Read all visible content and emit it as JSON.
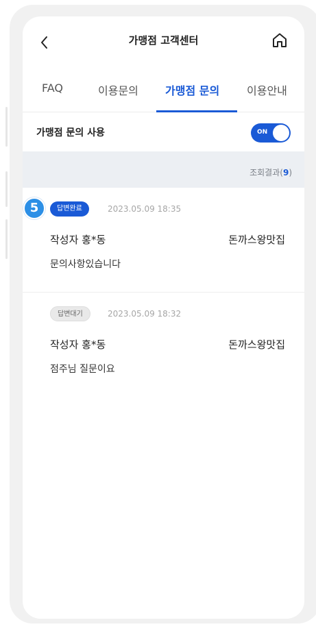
{
  "header": {
    "title": "가맹점 고객센터",
    "back_icon": "chevron-left-icon",
    "home_icon": "home-icon"
  },
  "tabs": [
    {
      "label": "FAQ",
      "active": false
    },
    {
      "label": "이용문의",
      "active": false
    },
    {
      "label": "가맹점 문의",
      "active": true
    },
    {
      "label": "이용안내",
      "active": false
    }
  ],
  "toggle_row": {
    "label": "가맹점 문의 사용",
    "toggle_text": "ON",
    "enabled": true
  },
  "results": {
    "label": "조회결과",
    "open": "(",
    "count": "9",
    "close": ")"
  },
  "inquiries": [
    {
      "badge_number": "5",
      "status": "답변완료",
      "datetime": "2023.05.09 18:35",
      "author": "작성자 홍*동",
      "store": "돈까스왕맛집",
      "content": "문의사항있습니다"
    },
    {
      "status": "답변대기",
      "datetime": "2023.05.09 18:32",
      "author": "작성자 홍*동",
      "store": "돈까스왕맛집",
      "content": "점주님 질문이요"
    }
  ],
  "colors": {
    "accent": "#1a5ad6",
    "badge": "#2c8fe6",
    "result_bar": "#eceff3"
  }
}
